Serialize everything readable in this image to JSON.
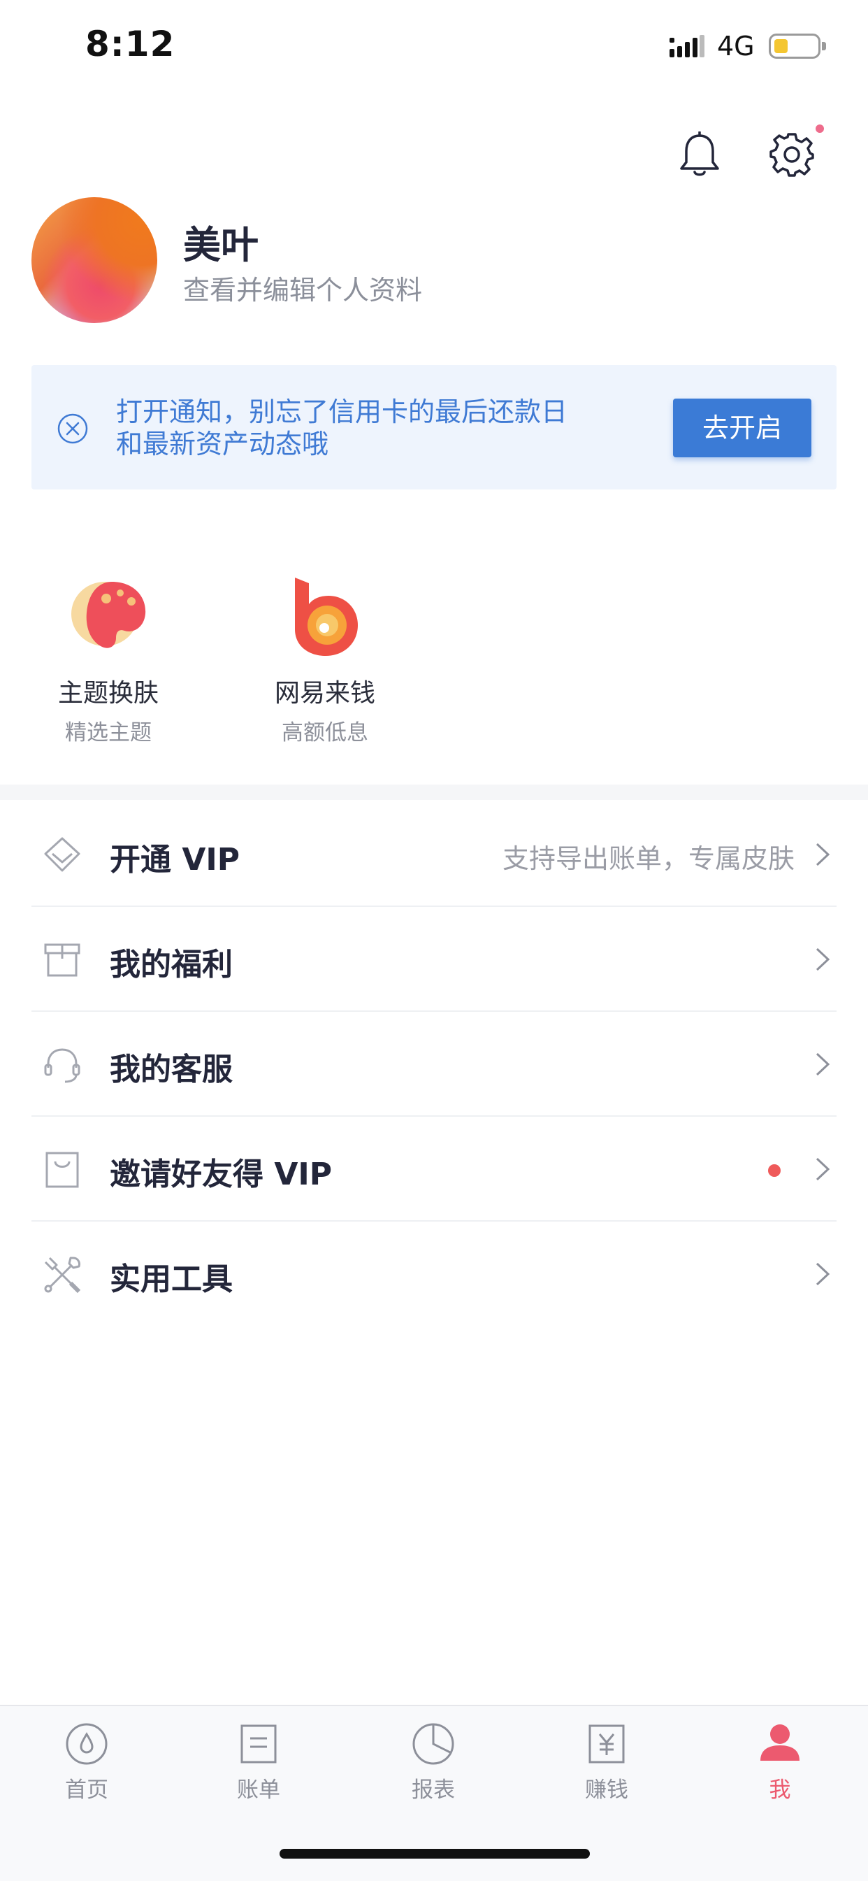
{
  "status_bar": {
    "time": "8:12",
    "network": "4G",
    "battery_level": 0.3
  },
  "header": {
    "notification_dot_color": "#ee6c8c"
  },
  "profile": {
    "name": "美叶",
    "link": "查看并编辑个人资料"
  },
  "banner": {
    "text_line1": "打开通知，别忘了信用卡的最后还款日",
    "text_line2": "和最新资产动态哦",
    "button": "去开启"
  },
  "tiles": [
    {
      "title": "主题换肤",
      "subtitle": "精选主题",
      "icon": "palette-icon"
    },
    {
      "title": "网易来钱",
      "subtitle": "高额低息",
      "icon": "loan-logo-icon"
    }
  ],
  "menu": [
    {
      "label": "开通 VIP",
      "hint": "支持导出账单，专属皮肤",
      "icon": "diamond-icon"
    },
    {
      "label": "我的福利",
      "icon": "gift-box-icon"
    },
    {
      "label": "我的客服",
      "icon": "headset-icon"
    },
    {
      "label": "邀请好友得 VIP",
      "icon": "shopping-bag-icon",
      "has_badge": true
    },
    {
      "label": "实用工具",
      "icon": "tools-icon"
    }
  ],
  "tab_bar": [
    {
      "label": "首页",
      "icon": "home-drop-icon",
      "active": false
    },
    {
      "label": "账单",
      "icon": "bill-icon",
      "active": false
    },
    {
      "label": "报表",
      "icon": "pie-chart-icon",
      "active": false
    },
    {
      "label": "赚钱",
      "icon": "yuan-icon",
      "active": false
    },
    {
      "label": "我",
      "icon": "person-icon",
      "active": true
    }
  ],
  "colors": {
    "accent_blue": "#3b7bd6",
    "active_tab": "#ec5a6f",
    "badge_red": "#ef5a5a"
  }
}
